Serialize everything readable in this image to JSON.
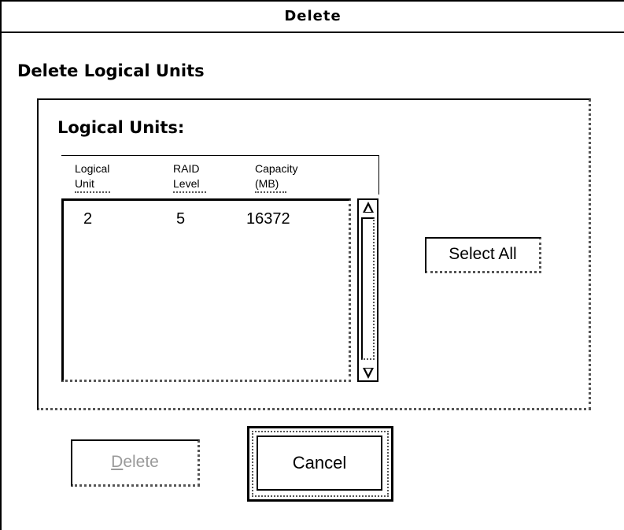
{
  "window": {
    "title": "Delete"
  },
  "dialog": {
    "heading": "Delete Logical Units",
    "group_label": "Logical Units:",
    "columns": [
      {
        "line1": "Logical",
        "line2": "Unit"
      },
      {
        "line1": "RAID",
        "line2": "Level"
      },
      {
        "line1": "Capacity",
        "line2": "(MB)"
      }
    ],
    "rows": [
      {
        "logical_unit": "2",
        "raid_level": "5",
        "capacity_mb": "16372"
      }
    ],
    "select_all_label": "Select All"
  },
  "buttons": {
    "delete_label_first": "D",
    "delete_label_rest": "elete",
    "delete_state": "disabled",
    "cancel_label": "Cancel"
  },
  "icons": [
    "scroll-up-arrow-icon",
    "scroll-down-arrow-icon"
  ]
}
